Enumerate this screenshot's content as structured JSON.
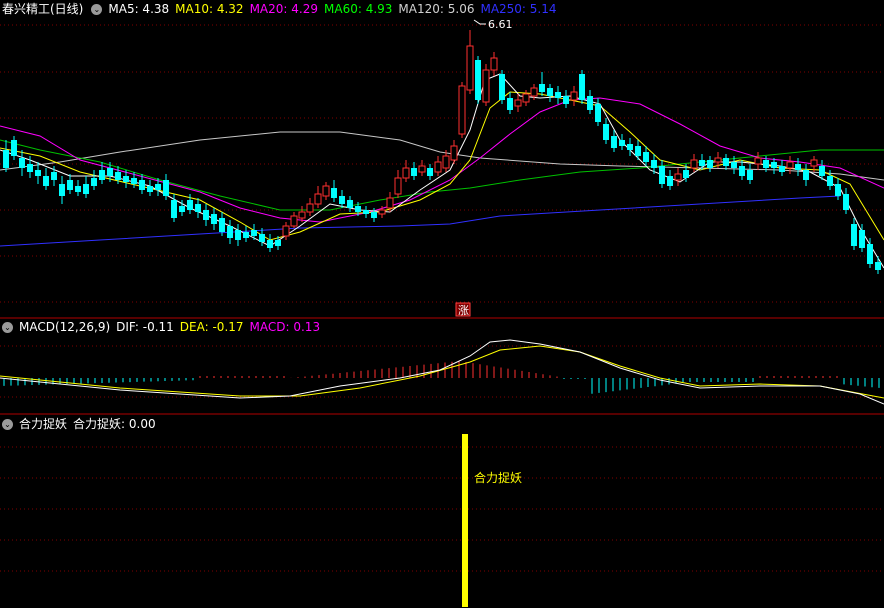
{
  "main": {
    "title": "春兴精工(日线)",
    "ma": [
      {
        "label": "MA5: 4.38",
        "color": "#ffffff"
      },
      {
        "label": "MA10: 4.32",
        "color": "#ffff00"
      },
      {
        "label": "MA20: 4.29",
        "color": "#ff00ff"
      },
      {
        "label": "MA60: 4.93",
        "color": "#00ff00"
      },
      {
        "label": "MA120: 5.06",
        "color": "#d0d0d0"
      },
      {
        "label": "MA250: 5.14",
        "color": "#3030ff"
      }
    ],
    "high_label": "6.61",
    "zhang_label": "涨"
  },
  "macd": {
    "title": "MACD(12,26,9)",
    "dif": "DIF: -0.11",
    "dea": "DEA: -0.17",
    "macd": "MACD: 0.13"
  },
  "indicator": {
    "title": "合力捉妖",
    "value": "合力捉妖: 0.00",
    "signal_label": "合力捉妖"
  },
  "colors": {
    "up": "#ff3030",
    "down": "#00ffff",
    "grid": "#800000",
    "signal": "#ffff00"
  }
}
